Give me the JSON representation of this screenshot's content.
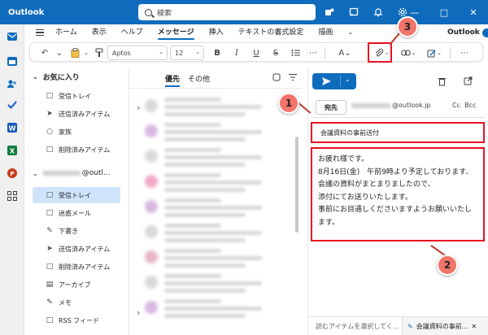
{
  "app": {
    "title": "Outlook"
  },
  "search": {
    "placeholder": "検索"
  },
  "ribbon": {
    "tabs": [
      "ホーム",
      "表示",
      "ヘルプ",
      "メッセージ",
      "挿入",
      "テキストの書式設定",
      "描画"
    ],
    "active_tab": "メッセージ",
    "toggle_label": "Outlook",
    "font": "Aptos",
    "font_size": "12"
  },
  "folders": {
    "favorites_label": "お気に入り",
    "favorites": [
      "受信トレイ",
      "送信済みアイテム",
      "家族",
      "削除済みアイテム"
    ],
    "account_suffix": "@outl...",
    "account_items": [
      "受信トレイ",
      "迷惑メール",
      "下書き",
      "送信済みアイテム",
      "削除済みアイテム",
      "アーカイブ",
      "メモ",
      "RSS フィード"
    ],
    "selected": "受信トレイ"
  },
  "message_list": {
    "tabs": [
      "優先",
      "その他"
    ],
    "active_tab": "優先"
  },
  "compose": {
    "to_label": "宛先",
    "to_address_suffix": "@outlook.jp",
    "cc_label": "Cc",
    "bcc_label": "Bcc",
    "subject": "会議資料の事前送付",
    "body": "お疲れ様です。\n8月16日(金)　午前9時より予定しております、\n会議の資料がまとまりましたので、\n添付にてお送りいたします。\n事前にお目通しくださいますようお願いいたします。"
  },
  "bottom_bar": {
    "left_text": "読むアイテムを選択してく...",
    "draft_tab": "会議資料の事前..."
  },
  "callouts": [
    "1",
    "2",
    "3"
  ],
  "colors": {
    "accent": "#0f6cbd",
    "highlight": "#e81123",
    "callout": "#f2746a"
  }
}
